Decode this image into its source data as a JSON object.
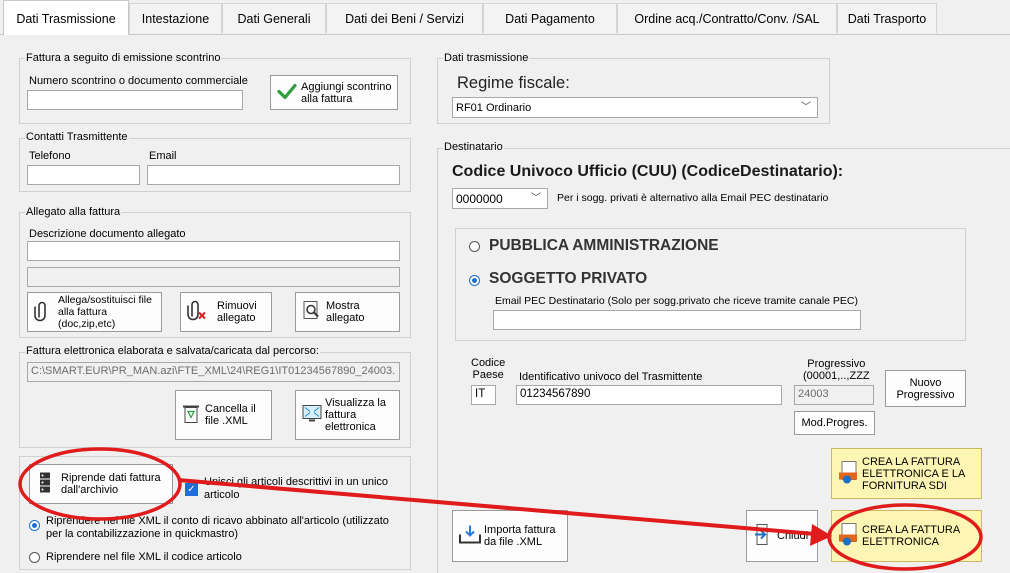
{
  "tabs": [
    {
      "label": "Dati Trasmissione",
      "active": true
    },
    {
      "label": "Intestazione"
    },
    {
      "label": "Dati Generali"
    },
    {
      "label": "Dati dei Beni / Servizi"
    },
    {
      "label": "Dati Pagamento"
    },
    {
      "label": "Ordine acq./Contratto/Conv. /SAL"
    },
    {
      "label": "Dati Trasporto"
    }
  ],
  "scontrino": {
    "group_label": "Fattura a seguito di emissione scontrino",
    "field_label": "Numero scontrino o documento commerciale",
    "field_value": "",
    "button_label": "Aggiungi scontrino\nalla fattura"
  },
  "contatti": {
    "group_label": "Contatti Trasmittente",
    "telefono_label": "Telefono",
    "email_label": "Email",
    "telefono_value": "",
    "email_value": ""
  },
  "allegato": {
    "group_label": "Allegato alla fattura",
    "descr_label": "Descrizione documento allegato",
    "descr_value": "",
    "file_value": "",
    "btn_allega": "Allega/sostituisci file\nalla fattura\n(doc,zip,etc)",
    "btn_rimuovi": "Rimuovi\nallegato",
    "btn_mostra": "Mostra\nallegato"
  },
  "fattura_elab": {
    "group_label": "Fattura elettronica elaborata e salvata/caricata dal percorso:",
    "path_value": "C:\\SMART.EUR\\PR_MAN.azi\\FTE_XML\\24\\REG1\\IT01234567890_24003.",
    "btn_cancella": "Cancella il\nfile .XML",
    "btn_visualizza": "Visualizza la\nfattura\nelettronica"
  },
  "archivio": {
    "btn_riprende": "Riprende dati fattura\ndall'archivio",
    "unisci_label": "Unisci gli articoli descrittivi in un unico\narticolo",
    "radio1_label": "Riprendere nel file XML il  conto di ricavo abbinato all'articolo (utilizzato\nper la contabilizzazione in quickmastro)",
    "radio2_label": "Riprendere nel file XML il codice articolo"
  },
  "dati_trasmissione": {
    "group_label": "Dati trasmissione",
    "regime_label": "Regime fiscale:",
    "regime_value": "RF01 Ordinario"
  },
  "destinatario": {
    "group_label": "Destinatario",
    "cuu_label": "Codice Univoco Ufficio (CUU) (CodiceDestinatario):",
    "cuu_value": "0000000",
    "cuu_note": "Per i sogg. privati è alternativo alla Email PEC destinatario",
    "pa_label": "PUBBLICA AMMINISTRAZIONE",
    "privato_label": "SOGGETTO PRIVATO",
    "pec_label": "Email PEC Destinatario (Solo per sogg.privato che riceve tramite canale PEC)",
    "pec_value": ""
  },
  "trasmittente": {
    "codice_paese_label": "Codice\nPaese",
    "codice_paese_value": "IT",
    "id_label": "Identificativo univoco del Trasmittente",
    "id_value": "01234567890",
    "progressivo_label": "Progressivo\n(00001,..,ZZZ",
    "progressivo_value": "24003",
    "btn_nuovo": "Nuovo\nProgressivo",
    "btn_mod": "Mod.Progres."
  },
  "actions": {
    "btn_crea_sdi": "CREA LA FATTURA\nELETTRONICA E LA\nFORNITURA SDI",
    "btn_importa": "Importa fattura\nda file .XML",
    "btn_chiudi": "Chiudi",
    "btn_crea": "CREA LA FATTURA\nELETTRONICA"
  },
  "colors": {
    "annotation_red": "#e01b1b",
    "accent_blue": "#1f6fd1"
  }
}
